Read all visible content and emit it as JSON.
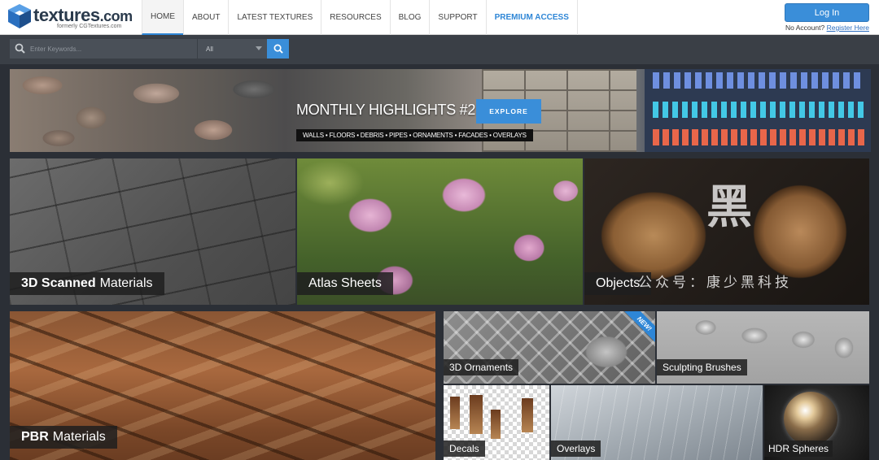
{
  "header": {
    "logo_name": "textures",
    "logo_tld": ".com",
    "logo_tagline": "formerly CGTextures.com",
    "login_label": "Log In",
    "no_account_text": "No Account?",
    "register_label": "Register Here"
  },
  "nav": [
    "HOME",
    "ABOUT",
    "LATEST TEXTURES",
    "RESOURCES",
    "BLOG",
    "SUPPORT",
    "PREMIUM ACCESS"
  ],
  "search": {
    "placeholder": "Enter Keywords...",
    "category": "All"
  },
  "banner": {
    "title": "MONTHLY HIGHLIGHTS #2",
    "cta": "EXPLORE",
    "subtitle": "WALLS • FLOORS • DEBRIS • PIPES • ORNAMENTS • FACADES • OVERLAYS"
  },
  "tiles": {
    "scanned": {
      "bold": "3D Scanned",
      "rest": "Materials"
    },
    "atlas": {
      "label": "Atlas Sheets"
    },
    "objects": {
      "label": "Objects"
    },
    "pbr": {
      "bold": "PBR",
      "rest": "Materials"
    },
    "ornaments": {
      "label": "3D Ornaments",
      "badge": "NEW!"
    },
    "sculpt": {
      "label": "Sculpting Brushes"
    },
    "decals": {
      "label": "Decals"
    },
    "overlays": {
      "label": "Overlays"
    },
    "hdr": {
      "label": "HDR Spheres"
    }
  },
  "watermark": {
    "big": "黑",
    "line": "公众号：康少黑科技"
  },
  "colors": {
    "accent": "#3a8ed9",
    "dark_bg": "#2b2f36",
    "search_bar_bg": "#3a3f46"
  }
}
